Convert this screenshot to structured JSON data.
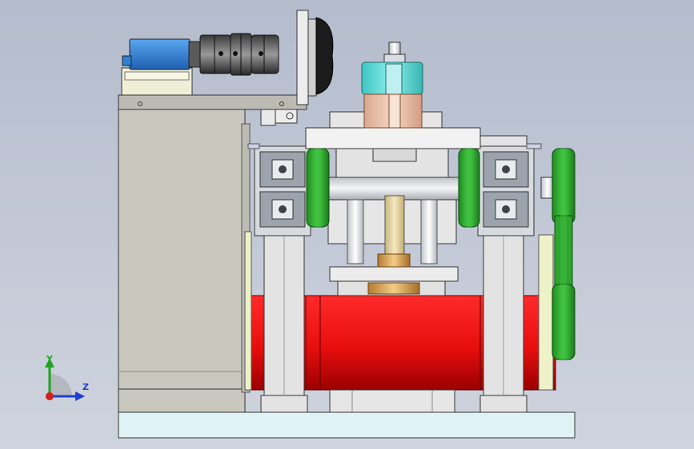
{
  "triad": {
    "y_label": "Y",
    "z_label": "Z"
  },
  "colors": {
    "background_top": "#b4bccd",
    "background_bottom": "#cfd4de",
    "frame_grey": "#c9c8bf",
    "light_grey": "#e3e3e3",
    "aluminium": "#d7dadf",
    "motor_red": "#ee1111",
    "pulley_green": "#2ea62e",
    "motor_blue": "#2f80d4",
    "cyan_collar": "#5fd9d6",
    "salmon_housing": "#f0c6ae",
    "bronze_nut": "#d9a55a",
    "base_cyan": "#dff3f6",
    "black_wheel": "#1b1b1b"
  },
  "icons": {
    "axis_triad": "xyz-axis-triad-icon"
  }
}
